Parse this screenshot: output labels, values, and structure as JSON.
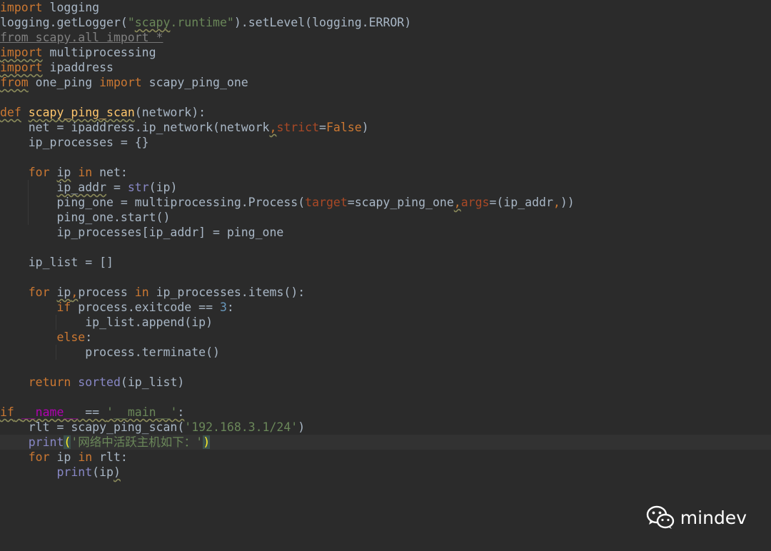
{
  "editor": {
    "lines": [
      [
        [
          "kw",
          "import"
        ],
        [
          "txt",
          " logging"
        ]
      ],
      [
        [
          "txt",
          "logging.getLogger("
        ],
        [
          "str",
          "\""
        ],
        [
          "str ul",
          "scapy"
        ],
        [
          "str",
          ".runtime\""
        ],
        [
          "txt",
          ").setLevel(logging.ERROR)"
        ]
      ],
      [
        [
          "unused ul-dim",
          "from scapy.all import *"
        ]
      ],
      [
        [
          "kw ul",
          "import"
        ],
        [
          "txt",
          " multiprocessing"
        ]
      ],
      [
        [
          "kw ul",
          "import"
        ],
        [
          "txt",
          " ipaddress"
        ]
      ],
      [
        [
          "kw ul",
          "from"
        ],
        [
          "txt",
          " one_ping "
        ],
        [
          "kw",
          "import"
        ],
        [
          "txt",
          " scapy_ping_one"
        ]
      ],
      [],
      [
        [
          "kw ul",
          "def"
        ],
        [
          "txt",
          " "
        ],
        [
          "fn ul",
          "scapy_ping_scan"
        ],
        [
          "txt",
          "(network):"
        ]
      ],
      [
        [
          "txt",
          "    net = ipaddress.ip_network(network"
        ],
        [
          "kw ul",
          ","
        ],
        [
          "param",
          "strict"
        ],
        [
          "txt",
          "="
        ],
        [
          "kw",
          "False"
        ],
        [
          "txt",
          ")"
        ]
      ],
      [
        [
          "txt",
          "    ip_processes = {}"
        ]
      ],
      [],
      [
        [
          "txt",
          "    "
        ],
        [
          "kw",
          "for"
        ],
        [
          "txt",
          " "
        ],
        [
          "txt ul",
          "ip"
        ],
        [
          "txt",
          " "
        ],
        [
          "kw",
          "in"
        ],
        [
          "txt",
          " net:"
        ]
      ],
      [
        [
          "txt",
          "        "
        ],
        [
          "txt ul",
          "ip_addr"
        ],
        [
          "txt",
          " = "
        ],
        [
          "builtin",
          "str"
        ],
        [
          "txt",
          "(ip)"
        ]
      ],
      [
        [
          "txt",
          "        ping_one = multiprocessing.Process("
        ],
        [
          "param",
          "target"
        ],
        [
          "txt",
          "=scapy_ping_one"
        ],
        [
          "kw ul",
          ","
        ],
        [
          "param",
          "args"
        ],
        [
          "txt",
          "=(ip_addr"
        ],
        [
          "kw",
          ","
        ],
        [
          "txt",
          "))"
        ]
      ],
      [
        [
          "txt",
          "        ping_one.start()"
        ]
      ],
      [
        [
          "txt",
          "        ip_processes[ip_addr] = ping_one"
        ]
      ],
      [],
      [
        [
          "txt",
          "    ip_list = []"
        ]
      ],
      [],
      [
        [
          "txt",
          "    "
        ],
        [
          "kw",
          "for"
        ],
        [
          "txt",
          " "
        ],
        [
          "txt ul",
          "ip"
        ],
        [
          "kw ul",
          ","
        ],
        [
          "txt",
          "process "
        ],
        [
          "kw",
          "in"
        ],
        [
          "txt",
          " ip_processes.items():"
        ]
      ],
      [
        [
          "txt",
          "        "
        ],
        [
          "kw",
          "if"
        ],
        [
          "txt",
          " process.exitcode == "
        ],
        [
          "num",
          "3"
        ],
        [
          "txt",
          ":"
        ]
      ],
      [
        [
          "txt",
          "            ip_list.append(ip)"
        ]
      ],
      [
        [
          "txt",
          "        "
        ],
        [
          "kw",
          "else"
        ],
        [
          "txt",
          ":"
        ]
      ],
      [
        [
          "txt",
          "            process.terminate()"
        ]
      ],
      [],
      [
        [
          "txt",
          "    "
        ],
        [
          "kw",
          "return"
        ],
        [
          "txt",
          " "
        ],
        [
          "builtin",
          "sorted"
        ],
        [
          "txt",
          "(ip_list)"
        ]
      ],
      [],
      [
        [
          "kw ul",
          "if"
        ],
        [
          "txt ul",
          " "
        ],
        [
          "magic ul",
          "__name__"
        ],
        [
          "txt ul",
          " == "
        ],
        [
          "str ul",
          "'__main__'"
        ],
        [
          "txt ul",
          ":"
        ]
      ],
      [
        [
          "txt",
          "    rlt = scapy_ping_scan("
        ],
        [
          "str",
          "'192.168.3.1/24'"
        ],
        [
          "txt",
          ")"
        ]
      ],
      [
        [
          "txt",
          "    "
        ],
        [
          "builtin",
          "print"
        ],
        [
          "tok-bracket",
          "("
        ],
        [
          "str",
          "'网络中活跃主机如下：'"
        ],
        [
          "tok-bracket",
          ")"
        ]
      ],
      [
        [
          "txt",
          "    "
        ],
        [
          "kw",
          "for"
        ],
        [
          "txt",
          " ip "
        ],
        [
          "kw",
          "in"
        ],
        [
          "txt",
          " rlt:"
        ]
      ],
      [
        [
          "txt",
          "        "
        ],
        [
          "builtin",
          "print"
        ],
        [
          "txt",
          "(ip"
        ],
        [
          "txt ul",
          ")"
        ]
      ]
    ],
    "current_line": 29
  },
  "watermark": {
    "text": "mindev",
    "icon": "wechat-icon"
  },
  "colors": {
    "background": "#2b2b2b",
    "keyword": "#cc7832",
    "function": "#ffc66d",
    "string": "#6a8759",
    "builtin": "#8888c6",
    "param": "#aa4926",
    "magic": "#b200b2",
    "number": "#6897bb"
  }
}
